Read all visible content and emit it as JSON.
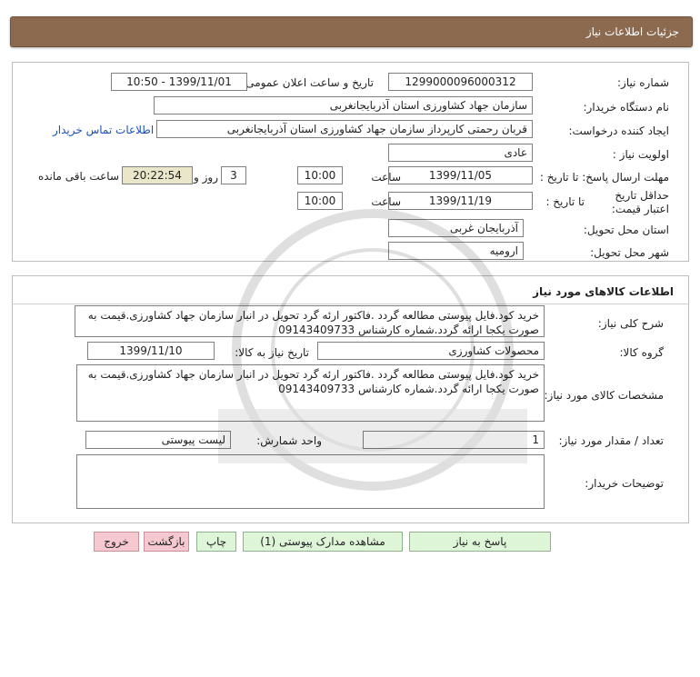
{
  "header": {
    "title": "جزئیات اطلاعات نیاز"
  },
  "details": {
    "need_number_label": "شماره نیاز:",
    "need_number": "1299000096000312",
    "announce_label": "تاریخ و ساعت اعلان عمومی:",
    "announce_value": "1399/11/01 - 10:50",
    "buyer_org_label": "نام دستگاه خریدار:",
    "buyer_org": "سازمان جهاد کشاورزی استان آذربایجانغربی",
    "requester_label": "ایجاد کننده درخواست:",
    "requester": "قربان  رحمتی  کارپرداز سازمان جهاد کشاورزی استان آذربایجانغربی",
    "contact_link": "اطلاعات تماس خریدار",
    "priority_label": "اولویت نیاز :",
    "priority": "عادی",
    "deadline_label": "مهلت ارسال پاسخ: تا تاریخ :",
    "deadline_date": "1399/11/05",
    "time_label": "ساعت",
    "deadline_time": "10:00",
    "days_value": "3",
    "days_label": "روز و",
    "remaining_time": "20:22:54",
    "remaining_label": "ساعت باقی مانده",
    "price_validity_label": "حداقل تاریخ اعتبار قیمت:",
    "price_validity_sub": "تا تاریخ :",
    "price_validity_date": "1399/11/19",
    "price_validity_time": "10:00",
    "province_label": "استان محل تحویل:",
    "province": "آذربایجان غربی",
    "city_label": "شهر محل تحویل:",
    "city": "ارومیه"
  },
  "goods": {
    "section_title": "اطلاعات کالاهای مورد نیاز",
    "summary_label": "شرح کلی نیاز:",
    "summary": "خرید کود.فایل پیوستی مطالعه گردد .فاکتور ارئه گرد تحویل در انبار سازمان جهاد کشاورزی.قیمت به صورت یکجا ارائه گردد.شماره کارشناس 09143409733",
    "group_label": "گروه کالا:",
    "group": "محصولات کشاورزی",
    "need_date_label": "تاریخ نیاز به کالا:",
    "need_date": "1399/11/10",
    "specs_label": "مشخصات کالای مورد نیاز:",
    "specs": "خرید کود.فایل پیوستی مطالعه گردد .فاکتور ارئه گرد تحویل در انبار سازمان جهاد کشاورزی.قیمت به صورت یکجا ارائه گردد.شماره کارشناس 09143409733",
    "qty_label": "تعداد / مقدار مورد نیاز:",
    "qty": "1",
    "unit_label": "واحد شمارش:",
    "unit": "لیست پیوستی",
    "buyer_notes_label": "توضیحات خریدار:",
    "buyer_notes": ""
  },
  "buttons": {
    "reply": "پاسخ به نیاز",
    "attachments": "مشاهده مدارک پیوستی (1)",
    "print": "چاپ",
    "back": "بازگشت",
    "exit": "خروج"
  }
}
